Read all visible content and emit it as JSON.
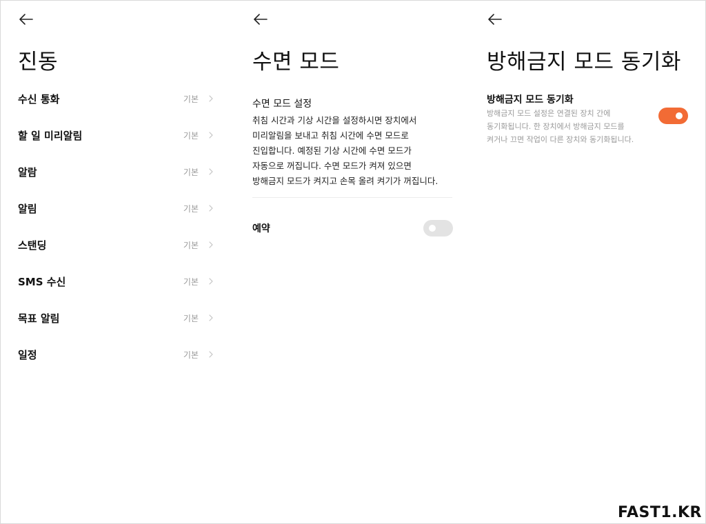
{
  "colors": {
    "accent": "#f26b35",
    "toggle_off": "#e3e3e3",
    "muted": "#9a9a9a"
  },
  "icons": {
    "back": "arrow-left-icon",
    "chevron": "chevron-right-icon"
  },
  "vibration": {
    "title": "진동",
    "items": [
      {
        "label": "수신 통화",
        "value": "기본"
      },
      {
        "label": "할 일 미리알림",
        "value": "기본"
      },
      {
        "label": "알람",
        "value": "기본"
      },
      {
        "label": "알림",
        "value": "기본"
      },
      {
        "label": "스탠딩",
        "value": "기본"
      },
      {
        "label": "SMS 수신",
        "value": "기본"
      },
      {
        "label": "목표 알림",
        "value": "기본"
      },
      {
        "label": "일정",
        "value": "기본"
      }
    ]
  },
  "sleep": {
    "title": "수면 모드",
    "section_title": "수면 모드 설정",
    "description_lines": [
      "취침 시간과 기상 시간을 설정하시면 장치에서",
      "미리알림을 보내고 취침 시간에 수면 모드로",
      "진입합니다. 예정된 기상 시간에 수면 모드가",
      "자동으로 꺼집니다. 수면 모드가 켜져 있으면",
      "방해금지 모드가 켜지고 손목 올려 켜기가 꺼집니다."
    ],
    "schedule_label": "예약",
    "schedule_on": false
  },
  "dnd_sync": {
    "title": "방해금지 모드 동기화",
    "setting_title": "방해금지 모드 동기화",
    "description_lines": [
      "방해금지 모드 설정은 연결된 장치 간에",
      "동기화됩니다. 한 장치에서 방해금지 모드를",
      "켜거나 끄면 작업이 다른 장치와 동기화됩니다."
    ],
    "sync_on": true
  },
  "watermark": "FAST1.KR"
}
